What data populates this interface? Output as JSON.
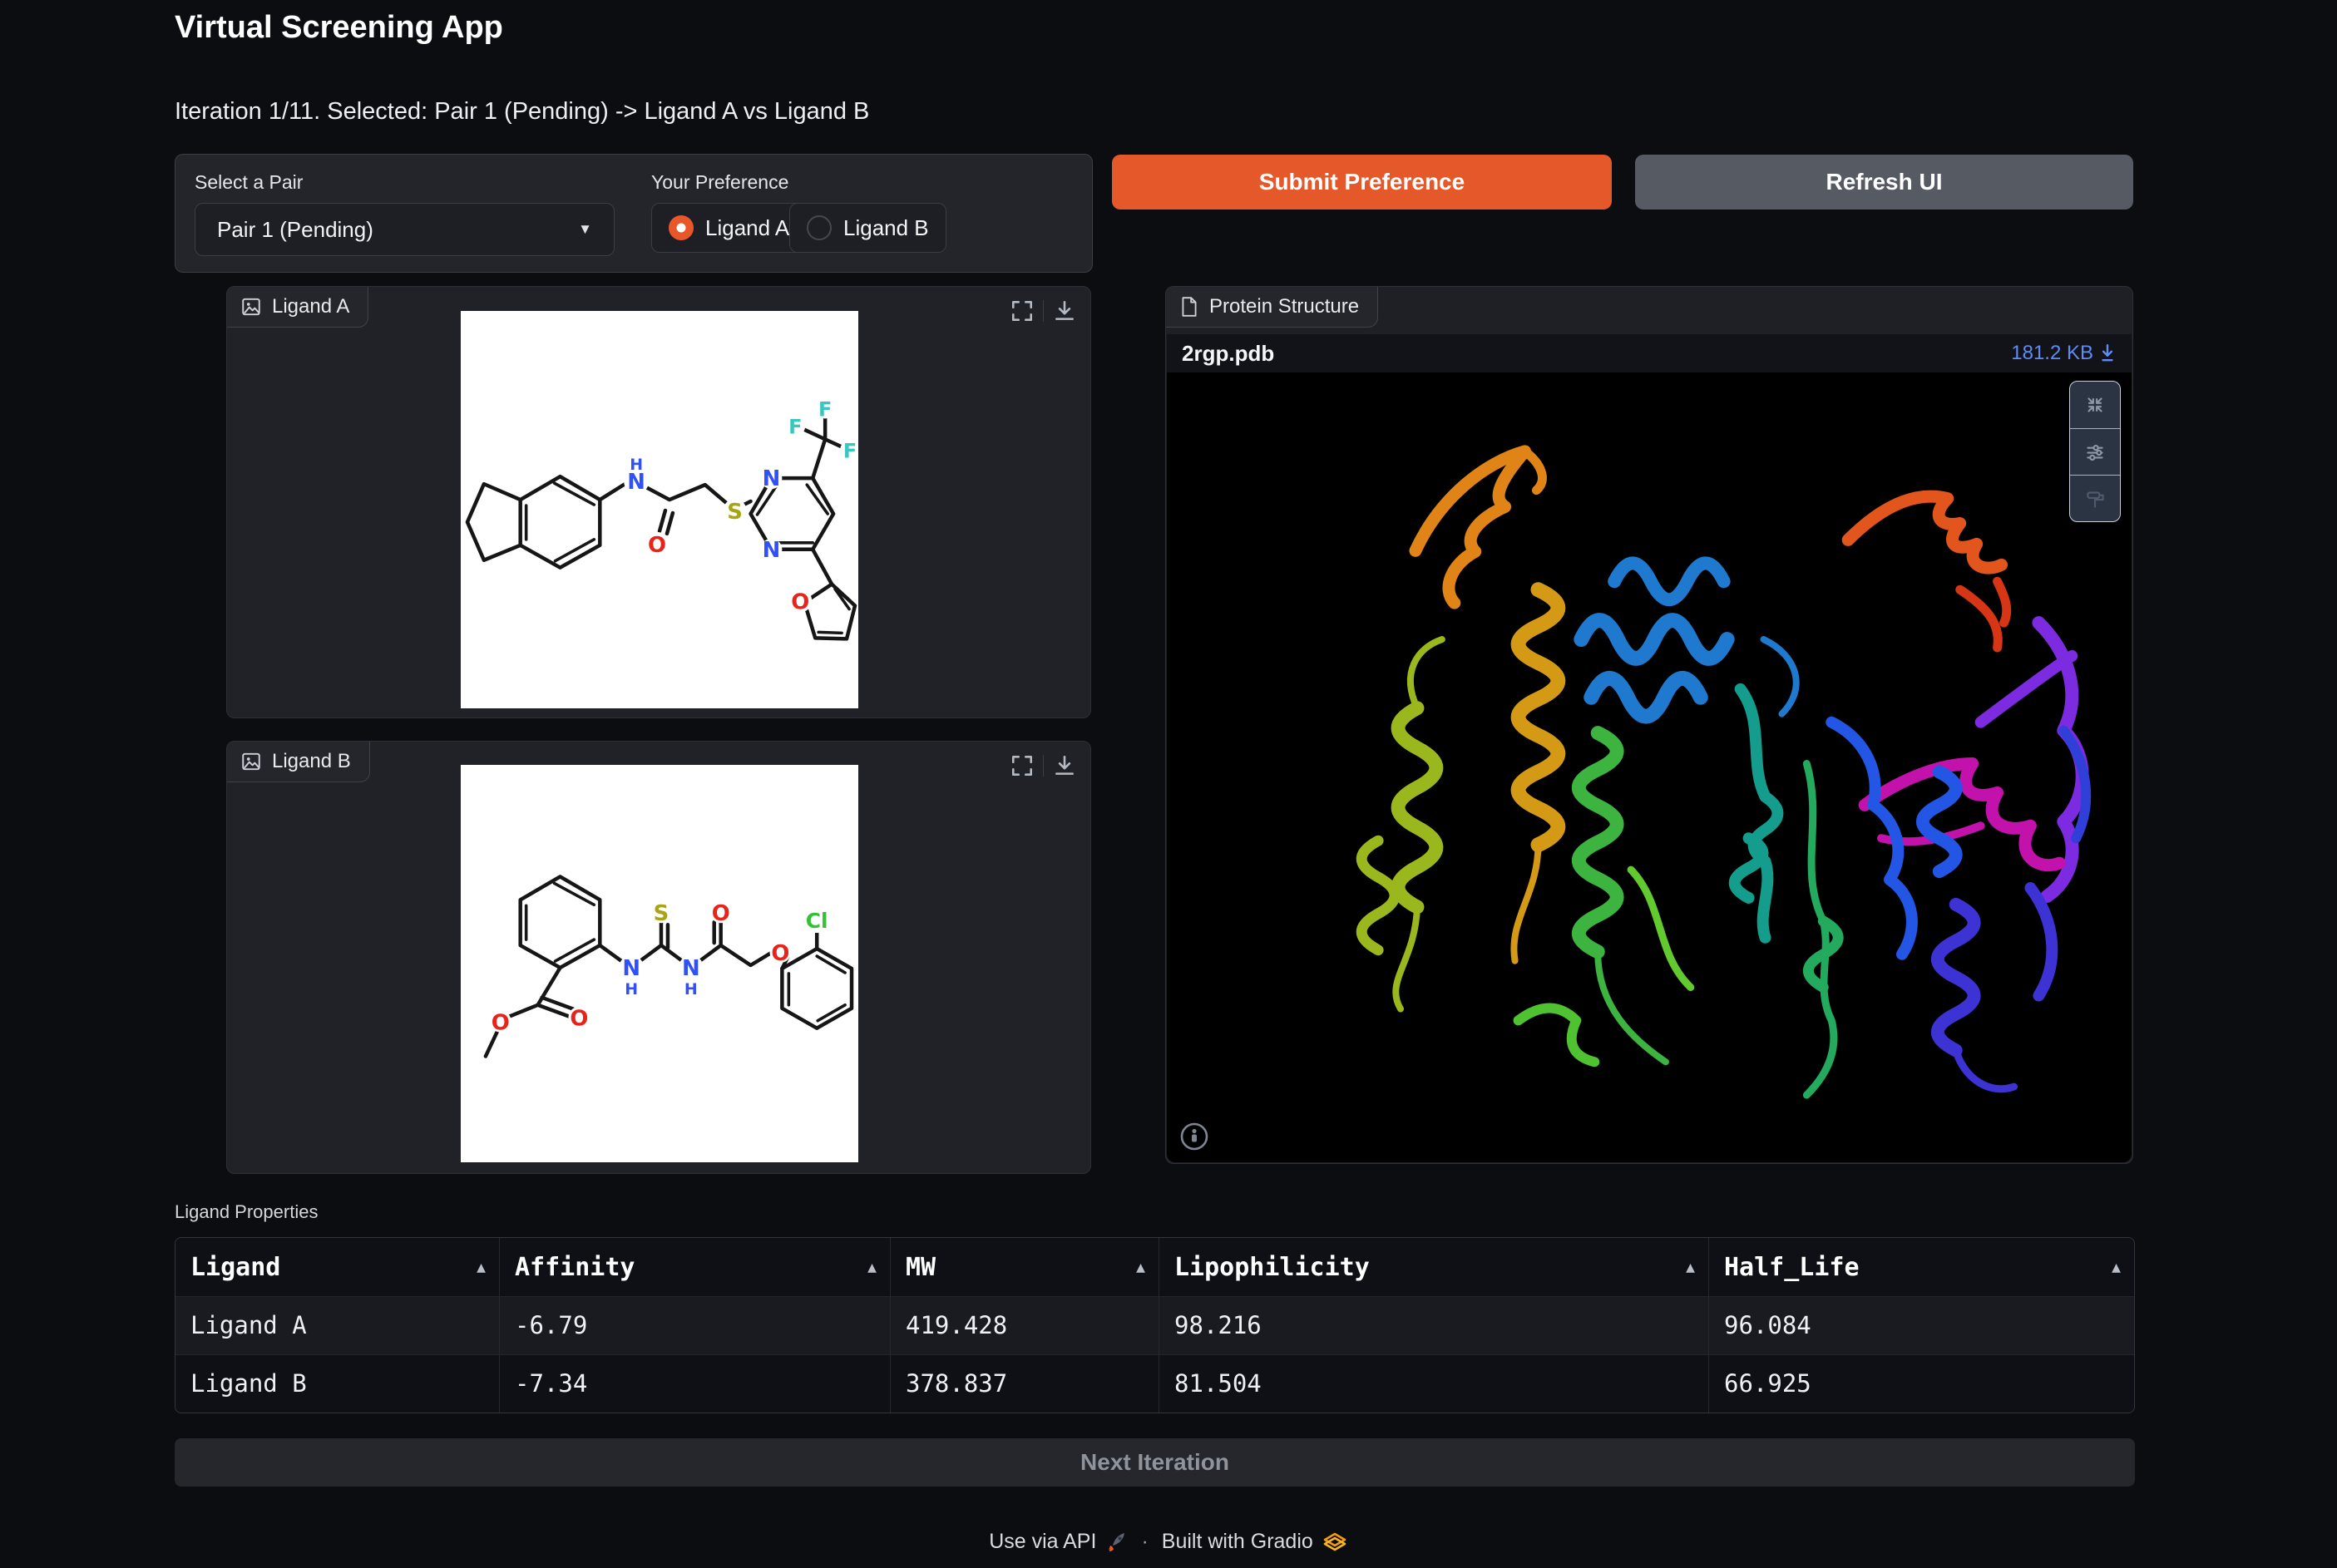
{
  "app": {
    "title": "Virtual Screening App",
    "status_line": "Iteration 1/11. Selected: Pair 1 (Pending) -> Ligand A vs Ligand B"
  },
  "controls": {
    "pair_select": {
      "label": "Select a Pair",
      "value": "Pair 1 (Pending)"
    },
    "preference": {
      "label": "Your Preference",
      "options": [
        {
          "label": "Ligand A",
          "selected": true
        },
        {
          "label": "Ligand B",
          "selected": false
        }
      ]
    },
    "submit_label": "Submit Preference",
    "refresh_label": "Refresh UI"
  },
  "ligand_a": {
    "label": "Ligand A"
  },
  "ligand_b": {
    "label": "Ligand B"
  },
  "protein": {
    "label": "Protein Structure",
    "filename": "2rgp.pdb",
    "filesize": "181.2 KB"
  },
  "table": {
    "caption": "Ligand Properties",
    "headers": [
      "Ligand",
      "Affinity",
      "MW",
      "Lipophilicity",
      "Half_Life"
    ],
    "rows": [
      [
        "Ligand A",
        "-6.79",
        "419.428",
        "98.216",
        "96.084"
      ],
      [
        "Ligand B",
        "-7.34",
        "378.837",
        "81.504",
        "66.925"
      ]
    ]
  },
  "next_button": "Next Iteration",
  "footer": {
    "api": "Use via API",
    "separator": "·",
    "gradio": "Built with Gradio"
  },
  "colors": {
    "accent": "#e8572a",
    "link": "#5f8bf5"
  }
}
